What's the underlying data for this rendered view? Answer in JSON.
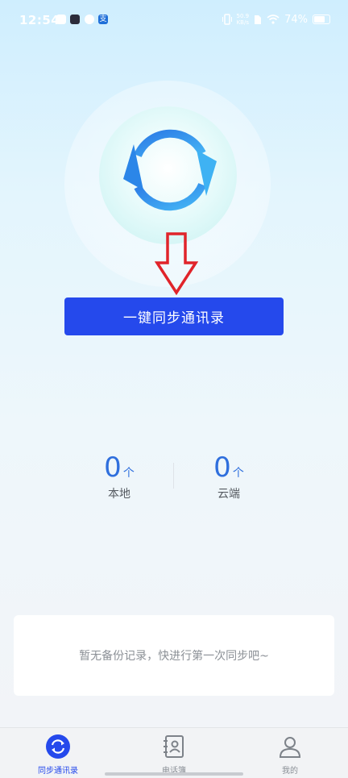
{
  "status_bar": {
    "time": "12:54",
    "speed_value": "50.9",
    "speed_unit": "KB/s",
    "battery": "74%",
    "icons": [
      "notification-app-icon",
      "video-app-icon",
      "link-app-icon",
      "alipay-icon",
      "vibrate-icon",
      "sim-icon",
      "wifi-icon",
      "battery-icon"
    ]
  },
  "hero": {
    "icon": "sync-icon",
    "arrow": "down-arrow-icon",
    "button_label": "一键同步通讯录"
  },
  "stats": {
    "local": {
      "count": "0",
      "unit": "个",
      "label": "本地"
    },
    "cloud": {
      "count": "0",
      "unit": "个",
      "label": "云端"
    }
  },
  "empty_state": {
    "message": "暂无备份记录，快进行第一次同步吧~"
  },
  "tab_bar": {
    "tabs": [
      {
        "label": "同步通讯录",
        "icon": "sync-icon",
        "active": true
      },
      {
        "label": "电话簿",
        "icon": "contacts-book-icon",
        "active": false
      },
      {
        "label": "我的",
        "icon": "profile-icon",
        "active": false
      }
    ]
  },
  "colors": {
    "primary": "#2549ec",
    "accent": "#2f6fdd",
    "arrow": "#e0242a"
  }
}
